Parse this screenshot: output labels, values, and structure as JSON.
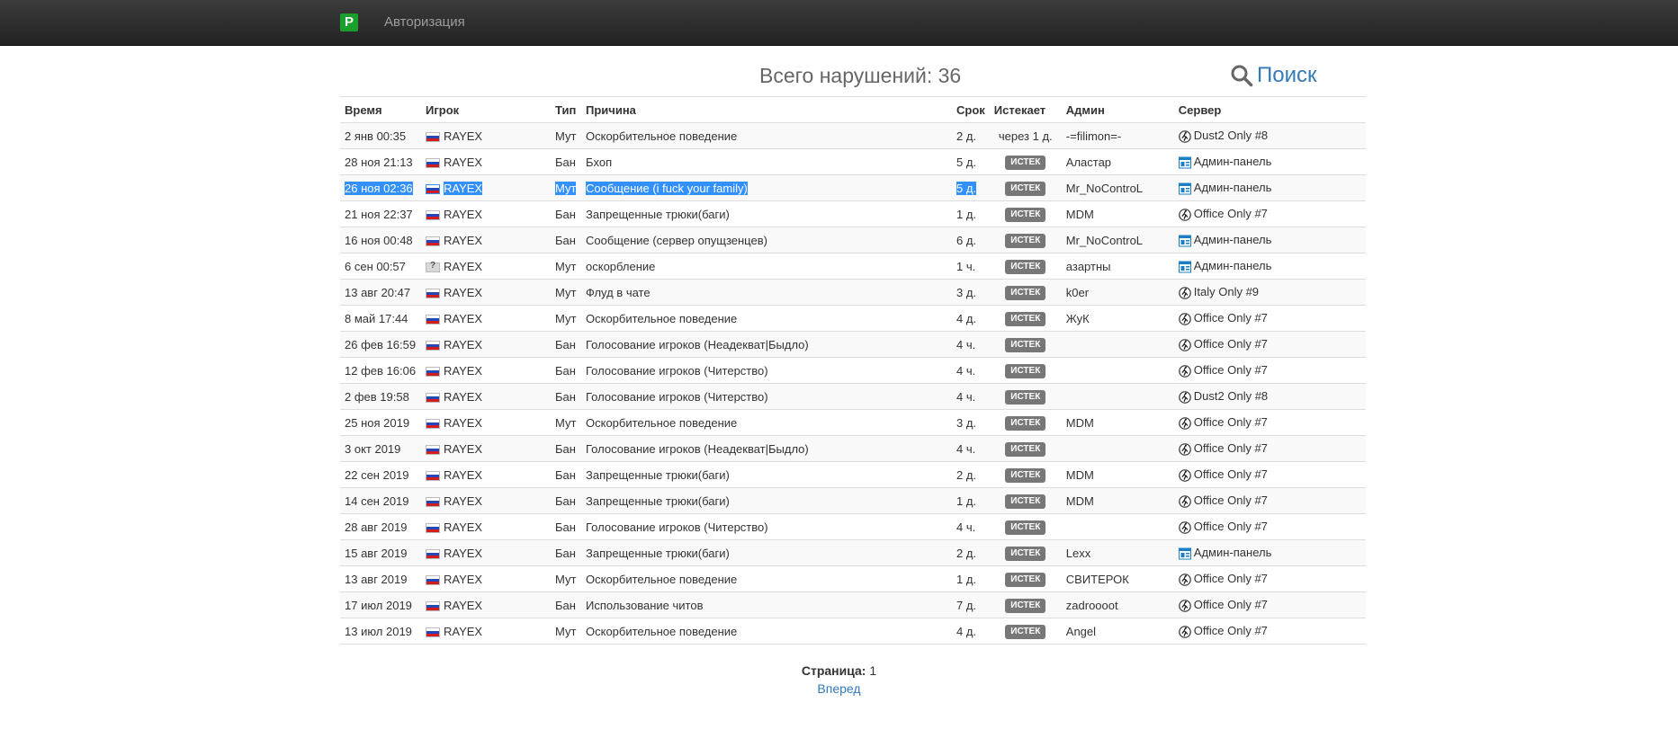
{
  "nav": {
    "brand": "P",
    "auth_label": "Авторизация"
  },
  "summary": {
    "total_label": "Всего нарушений: 36"
  },
  "search": {
    "label": "Поиск",
    "icon": "search-icon"
  },
  "columns": [
    "Время",
    "Игрок",
    "Тип",
    "Причина",
    "Срок",
    "Истекает",
    "Админ",
    "Сервер"
  ],
  "rows": [
    {
      "time": "2 янв 00:35",
      "player": "RAYEX",
      "flag": "ru",
      "type": "Мут",
      "reason": "Оскорбительное поведение",
      "term": "2 д.",
      "expires": "через 1 д.",
      "expires_badge": false,
      "admin": "-=filimon=-",
      "server": "Dust2 Only #8",
      "server_icon": "cs-icon"
    },
    {
      "time": "28 ноя 21:13",
      "player": "RAYEX",
      "flag": "ru",
      "type": "Бан",
      "reason": "Бхоп",
      "term": "5 д.",
      "expires": "ИСТЕК",
      "expires_badge": true,
      "admin": "Аластар",
      "server": "Админ-панель",
      "server_icon": "panel-icon"
    },
    {
      "time": "26 ноя 02:36",
      "player": "RAYEX",
      "flag": "ru",
      "type": "Мут",
      "reason": "Сообщение (i fuck your family)",
      "term": "5 д.",
      "expires": "ИСТЕК",
      "expires_badge": true,
      "admin": "Mr_NoControL",
      "server": "Админ-панель",
      "server_icon": "panel-icon",
      "selected": true
    },
    {
      "time": "21 ноя 22:37",
      "player": "RAYEX",
      "flag": "ru",
      "type": "Бан",
      "reason": "Запрещенные трюки(баги)",
      "term": "1 д.",
      "expires": "ИСТЕК",
      "expires_badge": true,
      "admin": "MDM",
      "server": "Office Only #7",
      "server_icon": "cs-icon"
    },
    {
      "time": "16 ноя 00:48",
      "player": "RAYEX",
      "flag": "ru",
      "type": "Бан",
      "reason": "Сообщение (сервер опущзенцев)",
      "term": "6 д.",
      "expires": "ИСТЕК",
      "expires_badge": true,
      "admin": "Mr_NoControL",
      "server": "Админ-панель",
      "server_icon": "panel-icon"
    },
    {
      "time": "6 сен 00:57",
      "player": "RAYEX",
      "flag": "unknown",
      "type": "Мут",
      "reason": "оскорбление",
      "term": "1 ч.",
      "expires": "ИСТЕК",
      "expires_badge": true,
      "admin": "азартны",
      "server": "Админ-панель",
      "server_icon": "panel-icon"
    },
    {
      "time": "13 авг 20:47",
      "player": "RAYEX",
      "flag": "ru",
      "type": "Мут",
      "reason": "Флуд в чате",
      "term": "3 д.",
      "expires": "ИСТЕК",
      "expires_badge": true,
      "admin": "k0er",
      "server": "Italy Only #9",
      "server_icon": "cs-icon"
    },
    {
      "time": "8 май 17:44",
      "player": "RAYEX",
      "flag": "ru",
      "type": "Мут",
      "reason": "Оскорбительное поведение",
      "term": "4 д.",
      "expires": "ИСТЕК",
      "expires_badge": true,
      "admin": "ЖуК",
      "server": "Office Only #7",
      "server_icon": "cs-icon"
    },
    {
      "time": "26 фев 16:59",
      "player": "RAYEX",
      "flag": "ru",
      "type": "Бан",
      "reason": "Голосование игроков (Неадекват|Быдло)",
      "term": "4 ч.",
      "expires": "ИСТЕК",
      "expires_badge": true,
      "admin": "",
      "server": "Office Only #7",
      "server_icon": "cs-icon"
    },
    {
      "time": "12 фев 16:06",
      "player": "RAYEX",
      "flag": "ru",
      "type": "Бан",
      "reason": "Голосование игроков (Читерство)",
      "term": "4 ч.",
      "expires": "ИСТЕК",
      "expires_badge": true,
      "admin": "",
      "server": "Office Only #7",
      "server_icon": "cs-icon"
    },
    {
      "time": "2 фев 19:58",
      "player": "RAYEX",
      "flag": "ru",
      "type": "Бан",
      "reason": "Голосование игроков (Читерство)",
      "term": "4 ч.",
      "expires": "ИСТЕК",
      "expires_badge": true,
      "admin": "",
      "server": "Dust2 Only #8",
      "server_icon": "cs-icon"
    },
    {
      "time": "25 ноя 2019",
      "player": "RAYEX",
      "flag": "ru",
      "type": "Мут",
      "reason": "Оскорбительное поведение",
      "term": "3 д.",
      "expires": "ИСТЕК",
      "expires_badge": true,
      "admin": "MDM",
      "server": "Office Only #7",
      "server_icon": "cs-icon"
    },
    {
      "time": "3 окт 2019",
      "player": "RAYEX",
      "flag": "ru",
      "type": "Бан",
      "reason": "Голосование игроков (Неадекват|Быдло)",
      "term": "4 ч.",
      "expires": "ИСТЕК",
      "expires_badge": true,
      "admin": "",
      "server": "Office Only #7",
      "server_icon": "cs-icon"
    },
    {
      "time": "22 сен 2019",
      "player": "RAYEX",
      "flag": "ru",
      "type": "Бан",
      "reason": "Запрещенные трюки(баги)",
      "term": "2 д.",
      "expires": "ИСТЕК",
      "expires_badge": true,
      "admin": "MDM",
      "server": "Office Only #7",
      "server_icon": "cs-icon"
    },
    {
      "time": "14 сен 2019",
      "player": "RAYEX",
      "flag": "ru",
      "type": "Бан",
      "reason": "Запрещенные трюки(баги)",
      "term": "1 д.",
      "expires": "ИСТЕК",
      "expires_badge": true,
      "admin": "MDM",
      "server": "Office Only #7",
      "server_icon": "cs-icon"
    },
    {
      "time": "28 авг 2019",
      "player": "RAYEX",
      "flag": "ru",
      "type": "Бан",
      "reason": "Голосование игроков (Читерство)",
      "term": "4 ч.",
      "expires": "ИСТЕК",
      "expires_badge": true,
      "admin": "",
      "server": "Office Only #7",
      "server_icon": "cs-icon"
    },
    {
      "time": "15 авг 2019",
      "player": "RAYEX",
      "flag": "ru",
      "type": "Бан",
      "reason": "Запрещенные трюки(баги)",
      "term": "2 д.",
      "expires": "ИСТЕК",
      "expires_badge": true,
      "admin": "Lexx",
      "server": "Админ-панель",
      "server_icon": "panel-icon"
    },
    {
      "time": "13 авг 2019",
      "player": "RAYEX",
      "flag": "ru",
      "type": "Мут",
      "reason": "Оскорбительное поведение",
      "term": "1 д.",
      "expires": "ИСТЕК",
      "expires_badge": true,
      "admin": "СВИТЕРОК",
      "server": "Office Only #7",
      "server_icon": "cs-icon"
    },
    {
      "time": "17 июл 2019",
      "player": "RAYEX",
      "flag": "ru",
      "type": "Бан",
      "reason": "Использование читов",
      "term": "7 д.",
      "expires": "ИСТЕК",
      "expires_badge": true,
      "admin": "zadroooot",
      "server": "Office Only #7",
      "server_icon": "cs-icon"
    },
    {
      "time": "13 июл 2019",
      "player": "RAYEX",
      "flag": "ru",
      "type": "Мут",
      "reason": "Оскорбительное поведение",
      "term": "4 д.",
      "expires": "ИСТЕК",
      "expires_badge": true,
      "admin": "Angel",
      "server": "Office Only #7",
      "server_icon": "cs-icon"
    }
  ],
  "pager": {
    "label": "Страница:",
    "page": "1",
    "next_label": "Вперед"
  },
  "colors": {
    "link": "#337ab7",
    "badge": "#777777",
    "selection": "#3390ff",
    "brand": "#1a9e2c"
  }
}
